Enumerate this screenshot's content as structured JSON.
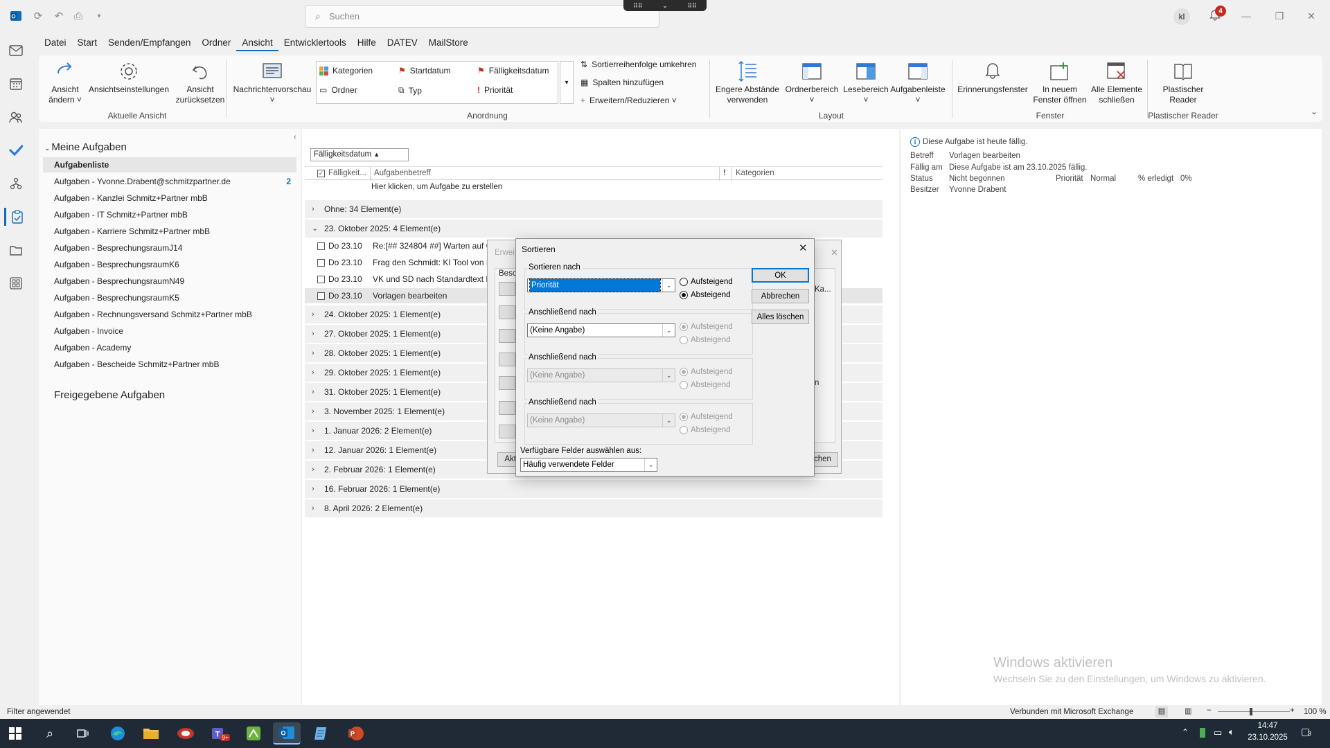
{
  "titlebar": {
    "search_placeholder": "Suchen",
    "avatar_initials": "kl",
    "notification_count": "4"
  },
  "menu": [
    "Datei",
    "Start",
    "Senden/Empfangen",
    "Ordner",
    "Ansicht",
    "Entwicklertools",
    "Hilfe",
    "DATEV",
    "MailStore"
  ],
  "menu_active": "Ansicht",
  "ribbon": {
    "ansicht_aendern": [
      "Ansicht",
      "ändern ˅"
    ],
    "ansichtseinstellungen": "Ansichtseinstellungen",
    "ansicht_zuruecksetzen": [
      "Ansicht",
      "zurücksetzen"
    ],
    "group_aktuelle_ansicht": "Aktuelle Ansicht",
    "nachrichtenvorschau": "Nachrichtenvorschau",
    "gallery": {
      "kategorien": "Kategorien",
      "startdatum": "Startdatum",
      "faelligkeitsdatum": "Fälligkeitsdatum",
      "ordner": "Ordner",
      "typ": "Typ",
      "prioritaet": "Priorität"
    },
    "sortierreihenfolge": "Sortierreihenfolge umkehren",
    "spalten_hinzufuegen": "Spalten hinzufügen",
    "erweitern": "Erweitern/Reduzieren ˅",
    "group_anordnung": "Anordnung",
    "engere_abstaende": [
      "Engere Abstände",
      "verwenden"
    ],
    "ordnerbereich": "Ordnerbereich",
    "lesebereich": "Lesebereich",
    "aufgabenleiste": "Aufgabenleiste",
    "group_layout": "Layout",
    "erinnerungsfenster": "Erinnerungsfenster",
    "in_neuem_fenster": [
      "In neuem",
      "Fenster öffnen"
    ],
    "alle_schliessen": [
      "Alle Elemente",
      "schließen"
    ],
    "group_fenster": "Fenster",
    "plastischer_reader": [
      "Plastischer",
      "Reader"
    ],
    "group_plastischer_reader": "Plastischer Reader"
  },
  "nav": {
    "header": "Meine Aufgaben",
    "items": [
      {
        "label": "Aufgabenliste",
        "count": ""
      },
      {
        "label": "Aufgaben - Yvonne.Drabent@schmitzpartner.de",
        "count": "2"
      },
      {
        "label": "Aufgaben - Kanzlei Schmitz+Partner mbB",
        "count": ""
      },
      {
        "label": "Aufgaben - IT Schmitz+Partner mbB",
        "count": ""
      },
      {
        "label": "Aufgaben - Karriere Schmitz+Partner mbB",
        "count": ""
      },
      {
        "label": "Aufgaben - BesprechungsraumJ14",
        "count": ""
      },
      {
        "label": "Aufgaben - BesprechungsraumK6",
        "count": ""
      },
      {
        "label": "Aufgaben - BesprechungsraumN49",
        "count": ""
      },
      {
        "label": "Aufgaben - BesprechungsraumK5",
        "count": ""
      },
      {
        "label": "Aufgaben - Rechnungsversand Schmitz+Partner mbB",
        "count": ""
      },
      {
        "label": "Aufgaben - Invoice",
        "count": ""
      },
      {
        "label": "Aufgaben - Academy",
        "count": ""
      },
      {
        "label": "Aufgaben - Bescheide Schmitz+Partner mbB",
        "count": ""
      }
    ],
    "shared_header": "Freigegebene Aufgaben"
  },
  "list": {
    "sort_field": "Fälligkeitsdatum",
    "col_due": "Fälligkeit...",
    "col_subject": "Aufgabenbetreff",
    "col_priority": "!",
    "col_categories": "Kategorien",
    "new_task_hint": "Hier klicken, um Aufgabe zu erstellen",
    "groups_top": [
      {
        "label": "Ohne: 34 Element(e)",
        "open": false
      },
      {
        "label": "23. Oktober 2025: 4 Element(e)",
        "open": true
      }
    ],
    "rows": [
      {
        "date": "Do 23.10",
        "subject": "Re:[## 324804 ##] Warten auf Gu"
      },
      {
        "date": "Do 23.10",
        "subject": "Frag den Schmidt: KI Tool von Be"
      },
      {
        "date": "Do 23.10",
        "subject": "VK und SD nach Standardtext E-M"
      },
      {
        "date": "Do 23.10",
        "subject": "Vorlagen bearbeiten"
      }
    ],
    "groups_bottom": [
      "24. Oktober 2025: 1 Element(e)",
      "27. Oktober 2025: 1 Element(e)",
      "28. Oktober 2025: 1 Element(e)",
      "29. Oktober 2025: 1 Element(e)",
      "31. Oktober 2025: 1 Element(e)",
      "3. November 2025: 1 Element(e)",
      "1. Januar 2026: 2 Element(e)",
      "12. Januar 2026: 1 Element(e)",
      "2. Februar 2026: 1 Element(e)",
      "16. Februar 2026: 1 Element(e)",
      "8. April 2026: 2 Element(e)"
    ]
  },
  "reading": {
    "info": "Diese Aufgabe ist heute fällig.",
    "betreff_label": "Betreff",
    "betreff": "Vorlagen bearbeiten",
    "faellig_label": "Fällig am",
    "faellig": "Diese Aufgabe ist am 23.10.2025 fällig.",
    "status_label": "Status",
    "status": "Nicht begonnen",
    "prio_label": "Priorität",
    "prio": "Normal",
    "erledigt_label": "% erledigt",
    "erledigt": "0%",
    "besitzer_label": "Besitzer",
    "besitzer": "Yvonne Drabent"
  },
  "watermark": {
    "title": "Windows aktivieren",
    "sub": "Wechseln Sie zu den Einstellungen, um Windows zu aktivieren."
  },
  "bgdialog": {
    "title": "Erwei",
    "label1": "Besc",
    "right1": "Ka...",
    "right2": "n",
    "btn_left": "Akt",
    "btn_right": "chen"
  },
  "sort_dialog": {
    "title": "Sortieren",
    "s1_label": "Sortieren nach",
    "s1_value": "Priorität",
    "s2_label": "Anschließend nach",
    "s2_value": "(Keine Angabe)",
    "s3_label": "Anschließend nach",
    "s3_value": "(Keine Angabe)",
    "s4_label": "Anschließend nach",
    "s4_value": "(Keine Angabe)",
    "asc": "Aufsteigend",
    "desc": "Absteigend",
    "ok": "OK",
    "cancel": "Abbrechen",
    "clear": "Alles löschen",
    "fields_label": "Verfügbare Felder auswählen aus:",
    "fields_value": "Häufig verwendete Felder"
  },
  "statusbar": {
    "left": "Filter angewendet",
    "connection": "Verbunden mit Microsoft Exchange",
    "zoom": "100 %"
  },
  "taskbar": {
    "time": "14:47",
    "date": "23.10.2025",
    "notif": "3",
    "teams_badge": "9+"
  },
  "colors": {
    "accent": "#0f6cbd",
    "taskbar": "#1f2a36",
    "selection": "#0078d7"
  }
}
